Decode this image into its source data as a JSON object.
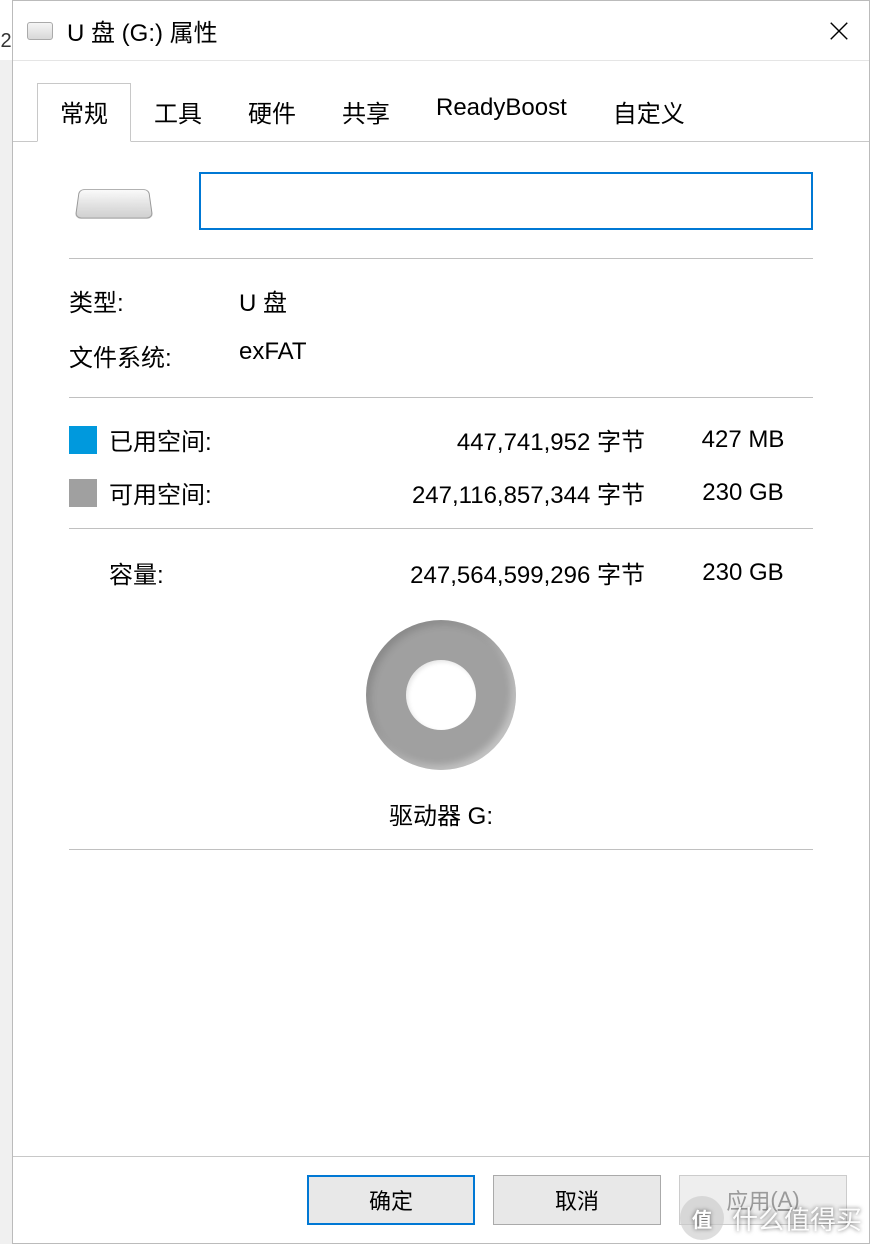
{
  "left_strip": "2",
  "window": {
    "title": "U 盘 (G:) 属性"
  },
  "tabs": {
    "items": [
      {
        "label": "常规"
      },
      {
        "label": "工具"
      },
      {
        "label": "硬件"
      },
      {
        "label": "共享"
      },
      {
        "label": "ReadyBoost"
      },
      {
        "label": "自定义"
      }
    ],
    "active_index": 0
  },
  "general": {
    "name_value": "",
    "type_label": "类型:",
    "type_value": "U 盘",
    "fs_label": "文件系统:",
    "fs_value": "exFAT",
    "used": {
      "label": "已用空间:",
      "bytes": "447,741,952 字节",
      "human": "427 MB",
      "color": "#0099dd"
    },
    "free": {
      "label": "可用空间:",
      "bytes": "247,116,857,344 字节",
      "human": "230 GB",
      "color": "#a0a0a0"
    },
    "capacity": {
      "label": "容量:",
      "bytes": "247,564,599,296 字节",
      "human": "230 GB"
    },
    "drive_caption": "驱动器 G:"
  },
  "chart_data": {
    "type": "pie",
    "title": "驱动器 G:",
    "series": [
      {
        "name": "已用空间",
        "values": [
          447741952
        ],
        "color": "#0099dd"
      },
      {
        "name": "可用空间",
        "values": [
          247116857344
        ],
        "color": "#a0a0a0"
      }
    ]
  },
  "buttons": {
    "ok": "确定",
    "cancel": "取消",
    "apply": "应用",
    "apply_hotkey": "A"
  },
  "watermark": {
    "badge": "值",
    "text": "什么值得买"
  }
}
